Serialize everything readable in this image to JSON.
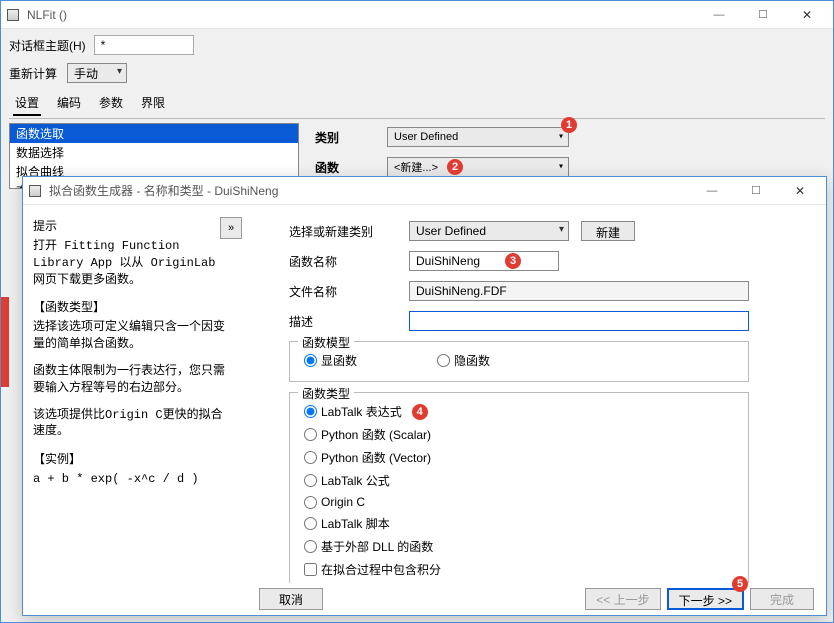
{
  "main": {
    "title": "NLFit ()",
    "theme_label": "对话框主题(H)",
    "theme_value": "*",
    "recalc_label": "重新计算",
    "recalc_value": "手动",
    "tabs": [
      "设置",
      "编码",
      "参数",
      "界限"
    ],
    "active_tab": 0,
    "list": [
      "函数选取",
      "数据选择",
      "拟合曲线",
      "查找X/Y"
    ],
    "list_sel": 0,
    "field_category": "类别",
    "field_category_val": "User Defined",
    "field_func": "函数",
    "field_func_val": "<新建...>"
  },
  "wizard": {
    "title": "拟合函数生成器 - 名称和类型 - DuiShiNeng",
    "left": {
      "hint_h": "提示",
      "hint_p1": "打开 Fitting Function Library App 以从 OriginLab 网页下载更多函数。",
      "sect1": "【函数类型】",
      "p2": "选择该选项可定义编辑只含一个因变量的简单拟合函数。",
      "p3": "函数主体限制为一行表达行，您只需要输入方程等号的右边部分。",
      "p4": "该选项提供比Origin C更快的拟合速度。",
      "sect2": "【实例】",
      "example": "a + b * exp( -x^c / d )"
    },
    "form": {
      "cat_label": "选择或新建类别",
      "cat_val": "User Defined",
      "cat_btn": "新建",
      "name_label": "函数名称",
      "name_val": "DuiShiNeng",
      "file_label": "文件名称",
      "file_val": "DuiShiNeng.FDF",
      "desc_label": "描述",
      "desc_val": "",
      "model_group": "函数模型",
      "model_opts": [
        "显函数",
        "隐函数"
      ],
      "model_sel": 0,
      "type_group": "函数类型",
      "type_opts": [
        "LabTalk 表达式",
        "Python 函数 (Scalar)",
        "Python 函数 (Vector)",
        "LabTalk 公式",
        "Origin C",
        "LabTalk 脚本",
        "基于外部 DLL 的函数"
      ],
      "type_sel": 0,
      "check_integral": "在拟合过程中包含积分"
    },
    "footer": {
      "cancel": "取消",
      "prev": "<< 上一步",
      "next": "下一步 >>",
      "finish": "完成"
    }
  },
  "badges": {
    "b1": "1",
    "b2": "2",
    "b3": "3",
    "b4": "4",
    "b5": "5"
  }
}
